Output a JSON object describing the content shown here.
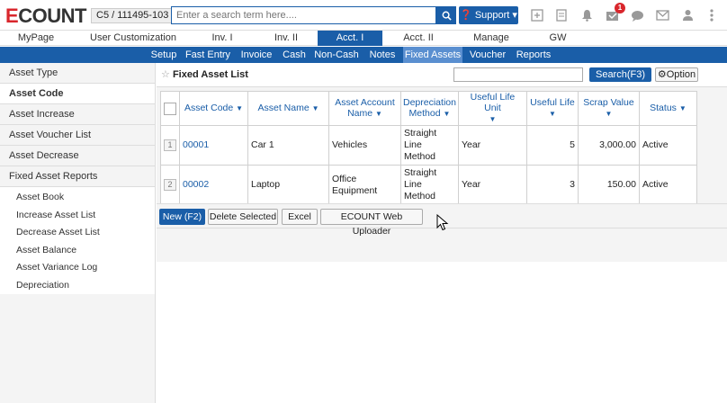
{
  "header": {
    "logo_e": "E",
    "logo_rest": "COUNT",
    "company_code": "C5 / 111495-103",
    "search_placeholder": "Enter a search term here....",
    "support_label": "Support ▾",
    "notification_count": "1"
  },
  "main_nav": [
    "MyPage",
    "User Customization",
    "Inv. I",
    "Inv. II",
    "Acct. I",
    "Acct. II",
    "Manage",
    "GW"
  ],
  "main_nav_active": "Acct. I",
  "sub_nav": [
    "Setup",
    "Fast Entry",
    "Invoice",
    "Cash",
    "Non-Cash",
    "Notes",
    "Fixed Assets",
    "Voucher",
    "Reports"
  ],
  "sub_nav_active": "Fixed Assets",
  "sidebar": {
    "items": [
      "Asset Type",
      "Asset Code",
      "Asset Increase",
      "Asset Voucher List",
      "Asset Decrease",
      "Fixed Asset Reports"
    ],
    "active": "Asset Code",
    "sub_items": [
      "Asset Book",
      "Increase Asset List",
      "Decrease Asset List",
      "Asset Balance",
      "Asset Variance Log",
      "Depreciation"
    ]
  },
  "page": {
    "title": "Fixed Asset List",
    "search_button": "Search(F3)",
    "option_button": "Option"
  },
  "table": {
    "columns": [
      "Asset Code",
      "Asset Name",
      "Asset Account Name",
      "Depreciation Method",
      "Useful Life Unit",
      "Useful Life",
      "Scrap Value",
      "Status"
    ],
    "rows": [
      {
        "num": "1",
        "code": "00001",
        "name": "Car 1",
        "account": "Vehicles",
        "method": "Straight Line Method",
        "unit": "Year",
        "life": "5",
        "scrap": "3,000.00",
        "status": "Active"
      },
      {
        "num": "2",
        "code": "00002",
        "name": "Laptop",
        "account": "Office Equipment",
        "method": "Straight Line Method",
        "unit": "Year",
        "life": "3",
        "scrap": "150.00",
        "status": "Active"
      }
    ]
  },
  "buttons": {
    "new": "New (F2)",
    "delete_selected": "Delete Selected",
    "excel": "Excel",
    "web_uploader": "ECOUNT Web Uploader"
  },
  "colors": {
    "brand_blue": "#1a5ea8",
    "logo_red": "#d9262c"
  }
}
